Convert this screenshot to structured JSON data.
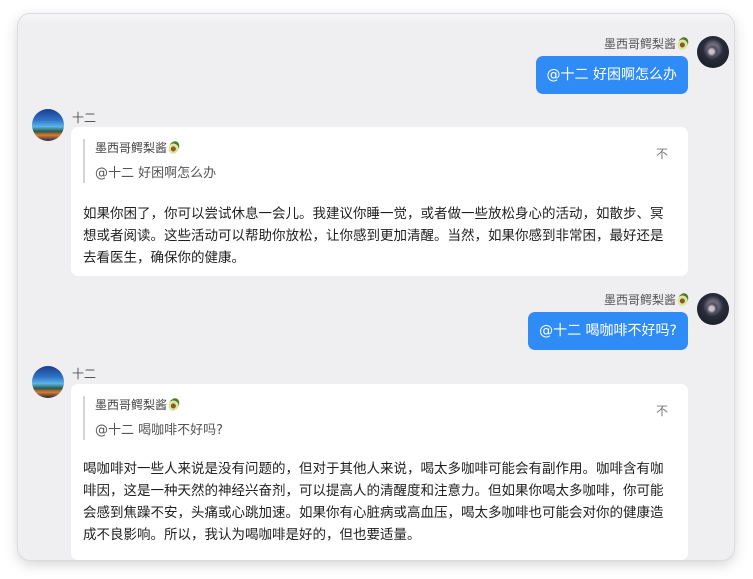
{
  "messages": [
    {
      "role": "user",
      "name": "墨西哥鳄梨酱",
      "text": "@十二 好困啊怎么办"
    },
    {
      "role": "bot",
      "name": "十二",
      "quote_name": "墨西哥鳄梨酱",
      "quote_text": "@十二 好困啊怎么办",
      "pin_label": "不",
      "answer": "如果你困了，你可以尝试休息一会儿。我建议你睡一觉，或者做一些放松身心的活动，如散步、冥想或者阅读。这些活动可以帮助你放松，让你感到更加清醒。当然，如果你感到非常困，最好还是去看医生，确保你的健康。"
    },
    {
      "role": "user",
      "name": "墨西哥鳄梨酱",
      "text": "@十二 喝咖啡不好吗?"
    },
    {
      "role": "bot",
      "name": "十二",
      "quote_name": "墨西哥鳄梨酱",
      "quote_text": "@十二 喝咖啡不好吗?",
      "pin_label": "不",
      "answer": "喝咖啡对一些人来说是没有问题的，但对于其他人来说，喝太多咖啡可能会有副作用。咖啡含有咖啡因，这是一种天然的神经兴奋剂，可以提高人的清醒度和注意力。但如果你喝太多咖啡，你可能会感到焦躁不安，头痛或心跳加速。如果你有心脏病或高血压，喝太多咖啡也可能会对你的健康造成不良影响。所以，我认为喝咖啡是好的，但也要适量。"
    }
  ],
  "colors": {
    "user_bubble": "#2f8cf7",
    "background": "#efeff2",
    "card": "#ffffff"
  },
  "icons": {
    "user_name_emoji": "avocado-icon"
  }
}
